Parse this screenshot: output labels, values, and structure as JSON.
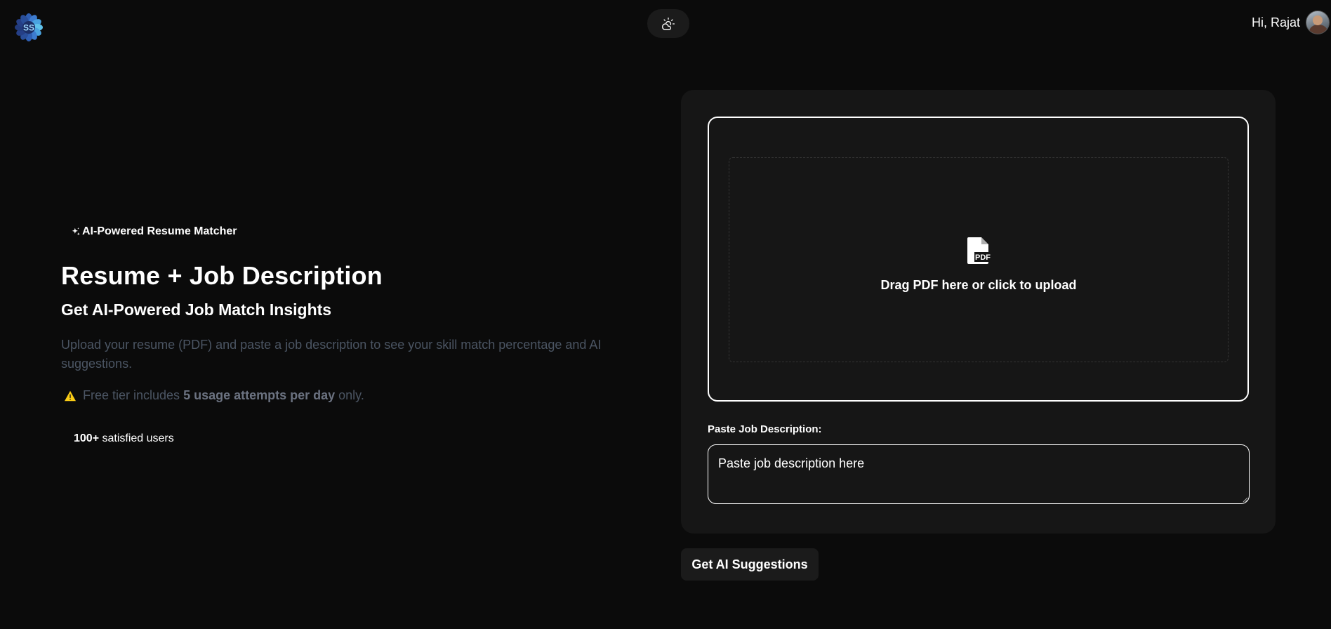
{
  "header": {
    "logo_icon": "ss-flower-logo-icon",
    "theme_toggle_icon": "partly-cloudy-icon",
    "greeting": "Hi, Rajat"
  },
  "hero": {
    "badge_icon": "sparkles-icon",
    "badge": "AI-Powered Resume Matcher",
    "title": "Resume + Job Description",
    "subtitle": "Get AI-Powered Job Match Insights",
    "description": "Upload your resume (PDF) and paste a job description to see your skill match percentage and AI suggestions.",
    "notice": {
      "icon": "warning-icon",
      "prefix": "Free tier includes ",
      "emphasis": "5 usage attempts per day",
      "suffix": " only."
    },
    "users": {
      "count": "100+",
      "label": " satisfied users"
    }
  },
  "upload": {
    "icon": "pdf-file-icon",
    "icon_label": "PDF",
    "prompt": "Drag PDF here or click to upload"
  },
  "job_description": {
    "label": "Paste Job Description:",
    "placeholder": "Paste job description here"
  },
  "cta": {
    "label": "Get AI Suggestions"
  },
  "colors": {
    "background": "#0b0b0b",
    "card": "#161616",
    "muted_text": "#4b5563",
    "warning": "#facc15"
  }
}
